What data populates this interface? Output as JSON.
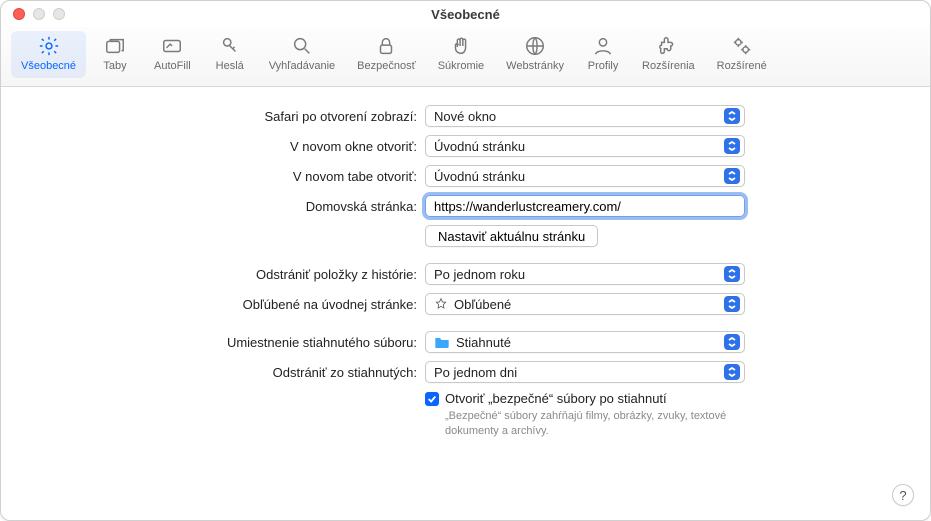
{
  "window": {
    "title": "Všeobecné"
  },
  "toolbar": {
    "items": [
      {
        "label": "Všeobecné"
      },
      {
        "label": "Taby"
      },
      {
        "label": "AutoFill"
      },
      {
        "label": "Heslá"
      },
      {
        "label": "Vyhľadávanie"
      },
      {
        "label": "Bezpečnosť"
      },
      {
        "label": "Súkromie"
      },
      {
        "label": "Webstránky"
      },
      {
        "label": "Profily"
      },
      {
        "label": "Rozšírenia"
      },
      {
        "label": "Rozšírené"
      }
    ]
  },
  "labels": {
    "open_shows": "Safari po otvorení zobrazí:",
    "new_window": "V novom okne otvoriť:",
    "new_tab": "V novom tabe otvoriť:",
    "homepage": "Domovská stránka:",
    "set_current": "Nastaviť aktuálnu stránku",
    "remove_history": "Odstrániť položky z histórie:",
    "favorites_on_start": "Obľúbené na úvodnej stránke:",
    "download_location": "Umiestnenie stiahnutého súboru:",
    "remove_downloads": "Odstrániť zo stiahnutých:",
    "open_safe": "Otvoriť „bezpečné“ súbory po stiahnutí",
    "safe_hint": "„Bezpečné“ súbory zahŕňajú filmy, obrázky, zvuky, textové dokumenty a archívy."
  },
  "values": {
    "open_shows": "Nové okno",
    "new_window": "Úvodnú stránku",
    "new_tab": "Úvodnú stránku",
    "homepage": "https://wanderlustcreamery.com/",
    "remove_history": "Po jednom roku",
    "favorites_on_start": "Obľúbené",
    "download_location": "Stiahnuté",
    "remove_downloads": "Po jednom dni"
  },
  "help": "?"
}
